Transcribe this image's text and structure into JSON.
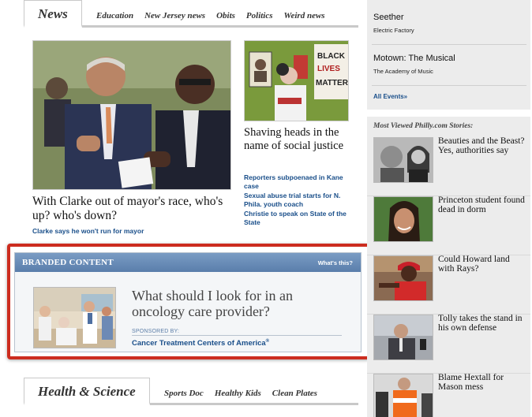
{
  "news_nav": {
    "active_tab": "News",
    "subnav": [
      "Education",
      "New Jersey news",
      "Obits",
      "Politics",
      "Weird news"
    ]
  },
  "lead_story": {
    "headline": "With Clarke out of mayor's race, who's up? who's down?",
    "related": "Clarke says he won't run for mayor"
  },
  "second_story": {
    "sign_text": "BLACK LIVES MATTER",
    "headline": "Shaving heads in the name of social justice",
    "related": [
      "Reporters subpoenaed in Kane case",
      "Sexual abuse trial starts for N. Phila. youth coach",
      "Christie to speak on State of the State"
    ]
  },
  "branded": {
    "header": "BRANDED CONTENT",
    "whats_this": "What's this?",
    "headline": "What should I look for in an oncology care provider?",
    "sponsored_label": "SPONSORED BY:",
    "sponsor": "Cancer Treatment Centers of America",
    "sponsor_mark": "®"
  },
  "health_nav": {
    "active_tab": "Health & Science",
    "subnav": [
      "Sports Doc",
      "Healthy Kids",
      "Clean Plates"
    ]
  },
  "events": {
    "items": [
      {
        "title": "Seether",
        "venue": "Electric Factory"
      },
      {
        "title": "Motown: The Musical",
        "venue": "The Academy of Music"
      }
    ],
    "all_link": "All Events»"
  },
  "most_viewed": {
    "title": "Most Viewed Philly.com Stories:",
    "items": [
      "Beauties and the Beast? Yes, authorities say",
      "Princeton student found dead in dorm",
      "Could Howard land with Rays?",
      "Tolly takes the stand in his own defense",
      "Blame Hextall for Mason mess"
    ]
  },
  "colors": {
    "link_blue": "#1a4f8a",
    "highlight_red": "#cc2c1f",
    "branded_header_blue": "#6a8dba",
    "sidebar_gray": "#ececec"
  }
}
